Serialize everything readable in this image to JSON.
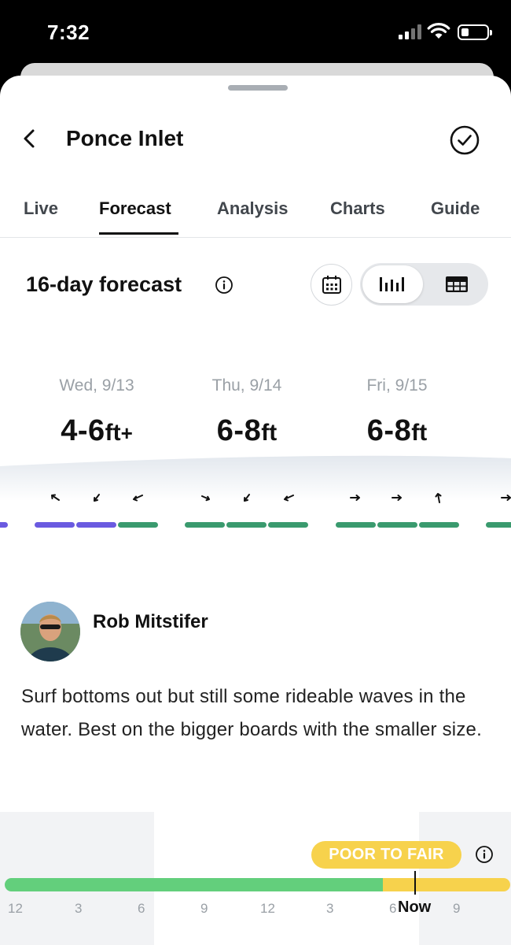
{
  "status_bar": {
    "time": "7:32"
  },
  "header": {
    "title": "Ponce Inlet"
  },
  "tabs": [
    {
      "label": "Live",
      "active": false
    },
    {
      "label": "Forecast",
      "active": true
    },
    {
      "label": "Analysis",
      "active": false
    },
    {
      "label": "Charts",
      "active": false
    },
    {
      "label": "Guide",
      "active": false
    }
  ],
  "forecast": {
    "title": "16-day forecast",
    "view_mode": "bars",
    "days": [
      {
        "date": "Wed, 9/13",
        "height": "4-6",
        "unit": "ft",
        "suffix": "+"
      },
      {
        "date": "Thu, 9/14",
        "height": "6-8",
        "unit": "ft",
        "suffix": ""
      },
      {
        "date": "Fri, 9/15",
        "height": "6-8",
        "unit": "ft",
        "suffix": ""
      }
    ],
    "colors": {
      "flat": "#6a5ae0",
      "fair": "#3a9a6e"
    }
  },
  "report": {
    "author": "Rob Mitstifer",
    "text": "Surf bottoms out but still some rideable waves in the water. Best on the bigger boards with the smaller size."
  },
  "conditions": {
    "rating": "POOR TO FAIR",
    "hours": [
      "12",
      "3",
      "6",
      "9",
      "12",
      "3",
      "6",
      "9"
    ],
    "now_label": "Now",
    "colors": {
      "poor_to_fair": "#63cf7c",
      "fair_to_good": "#f7d24c"
    }
  }
}
